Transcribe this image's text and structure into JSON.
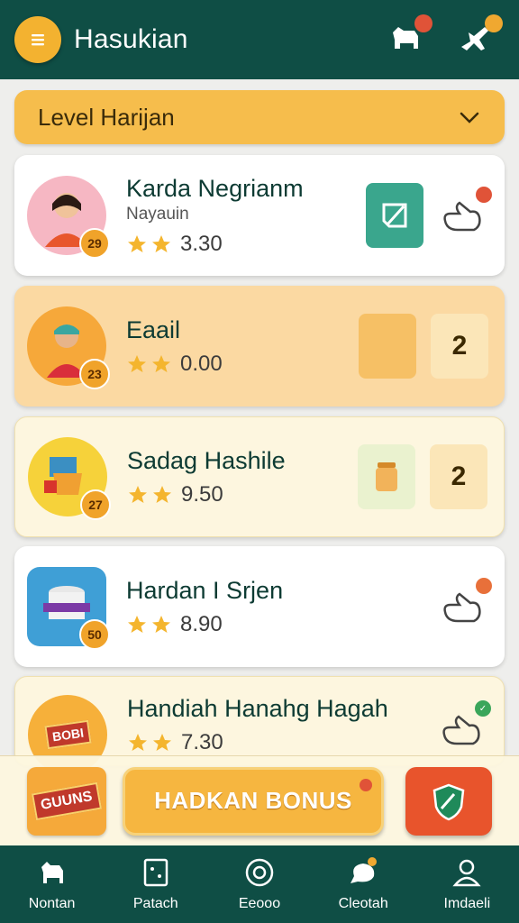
{
  "app": {
    "title": "Hasukian"
  },
  "level_filter": {
    "label": "Level Harijan"
  },
  "items": [
    {
      "title": "Karda Negrianm",
      "subtitle": "Nayauin",
      "rating": "3.30",
      "level": "29"
    },
    {
      "title": "Eaail",
      "subtitle": "",
      "rating": "0.00",
      "level": "23",
      "tile_label": "2"
    },
    {
      "title": "Sadag Hashile",
      "subtitle": "",
      "rating": "9.50",
      "level": "27",
      "tile_label": "2"
    },
    {
      "title": "Hardan I Srjen",
      "subtitle": "",
      "rating": "8.90",
      "level": "50"
    },
    {
      "title": "Handiah  Hanahg Hagah",
      "subtitle": "",
      "rating": "7.30",
      "logo_text": "BOBI"
    }
  ],
  "bonus": {
    "logo_text": "GUUNS",
    "button_label": "HADKAN BONUS"
  },
  "nav": [
    {
      "label": "Nontan",
      "icon": "dog-icon"
    },
    {
      "label": "Patach",
      "icon": "card-icon"
    },
    {
      "label": "Eeooo",
      "icon": "target-icon"
    },
    {
      "label": "Cleotah",
      "icon": "chat-icon"
    },
    {
      "label": "Imdaeli",
      "icon": "profile-icon"
    }
  ],
  "colors": {
    "primary": "#0f4e45",
    "accent": "#f3b230",
    "badge_red": "#e05338",
    "badge_green": "#3aa65a"
  }
}
